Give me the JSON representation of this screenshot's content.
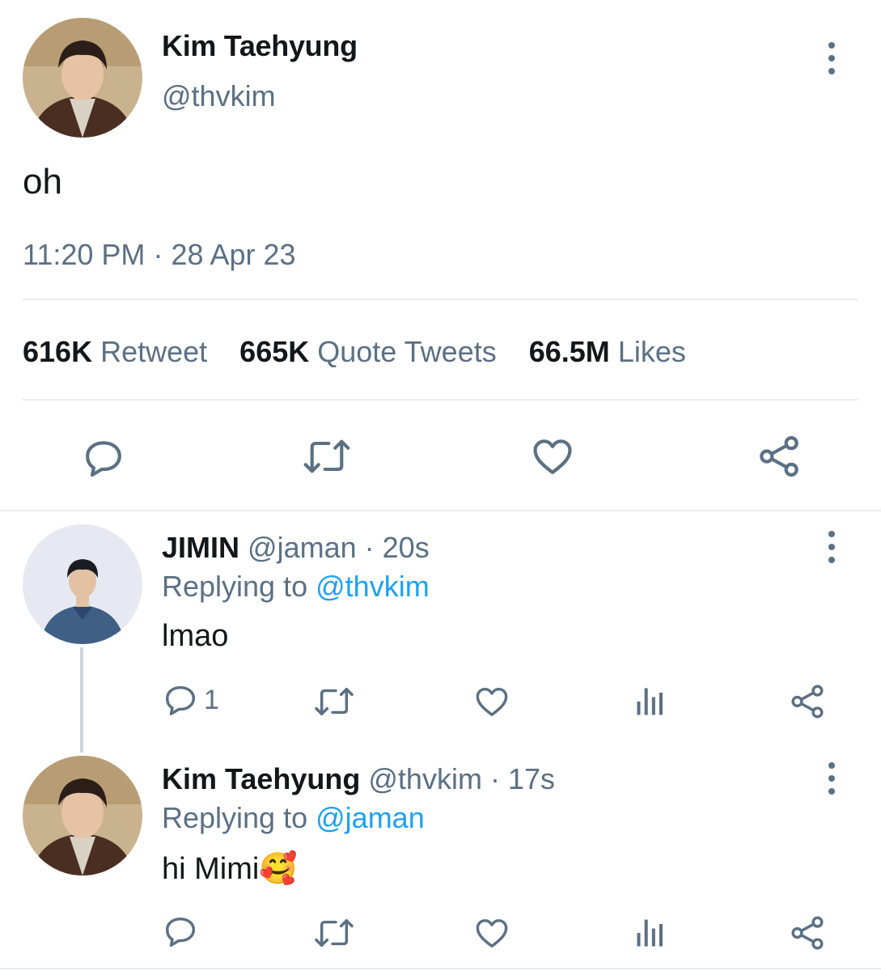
{
  "main_tweet": {
    "name": "Kim Taehyung",
    "handle": "@thvkim",
    "text": "oh",
    "time": "11:20 PM",
    "separator": "·",
    "date": "28 Apr 23",
    "stats": {
      "retweets_count": "616K",
      "retweets_label": "Retweet",
      "quotes_count": "665K",
      "quotes_label": "Quote Tweets",
      "likes_count": "66.5M",
      "likes_label": "Likes"
    },
    "actions": [
      "reply-icon",
      "retweet-icon",
      "like-icon",
      "share-icon"
    ]
  },
  "replies": [
    {
      "name": "JIMIN",
      "handle": "@jaman",
      "age": "· 20s",
      "replying_prefix": "Replying to",
      "replying_to": "@thvkim",
      "text": "lmao",
      "reply_count": "1"
    },
    {
      "name": "Kim Taehyung",
      "handle": "@thvkim",
      "age": "· 17s",
      "replying_prefix": "Replying to",
      "replying_to": "@jaman",
      "text": "hi Mimi",
      "emoji": "🥰",
      "reply_count": ""
    }
  ],
  "colors": {
    "text": "#14171a",
    "secondary": "#5b7083",
    "accent": "#1da1f2",
    "divider": "#e6ecf0"
  }
}
